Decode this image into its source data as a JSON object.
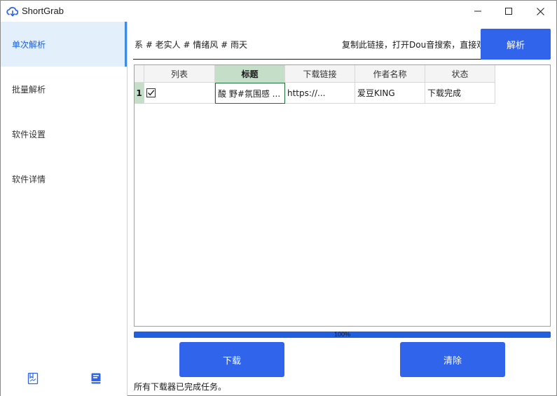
{
  "app": {
    "title": "ShortGrab",
    "accent": "#2f64eb"
  },
  "sidebar": {
    "items": [
      {
        "label": "单次解析",
        "active": true
      },
      {
        "label": "批量解析",
        "active": false
      },
      {
        "label": "软件设置",
        "active": false
      },
      {
        "label": "软件详情",
        "active": false
      }
    ],
    "bottom_icons": [
      "bookmark-outline-icon",
      "book-filled-icon"
    ]
  },
  "url_input": {
    "value_left": "系 # 老实人 # 情绪风 # 雨天",
    "value_right": "复制此链接，打开Dou音搜索，直接观"
  },
  "parse_button": {
    "label": "解析"
  },
  "table": {
    "columns": [
      "列表",
      "标题",
      "下载链接",
      "作者名称",
      "状态"
    ],
    "selected_column": "标题",
    "rows": [
      {
        "index": "1",
        "checked": true,
        "title": "酸 野#氛围感 ...",
        "link": "https://...",
        "author": "爱豆KING",
        "status": "下载完成"
      }
    ]
  },
  "progress": {
    "value": 100,
    "label": "100%"
  },
  "buttons": {
    "download": "下载",
    "clear": "清除"
  },
  "status_message": "所有下载器已完成任务。"
}
